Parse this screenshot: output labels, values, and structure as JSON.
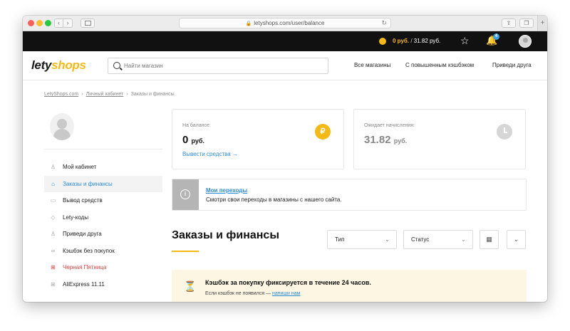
{
  "browser": {
    "url": "letyshops.com/user/balance",
    "back_glyph": "‹",
    "forward_glyph": "›",
    "new_tab_glyph": "+"
  },
  "topbar": {
    "balance_amount": "0 руб.",
    "balance_separator": "/",
    "pending_amount": "31.82 руб.",
    "notification_count": "4",
    "coin_color": "#f5b916"
  },
  "header": {
    "logo_part1": "lety",
    "logo_part2": "shops",
    "search_placeholder": "Найти магазин",
    "nav": [
      "Все магазины",
      "С повышенным кэшбэком",
      "Приведи друга"
    ]
  },
  "breadcrumb": {
    "items": [
      "LetyShops.com",
      "Личный кабинет",
      "Заказы и финансы"
    ],
    "separator": "›"
  },
  "sidebar": {
    "items": [
      {
        "label": "Мой кабинет",
        "icon": "user-icon"
      },
      {
        "label": "Заказы и финансы",
        "icon": "bag-icon"
      },
      {
        "label": "Вывод средств",
        "icon": "wallet-icon"
      },
      {
        "label": "Lety-коды",
        "icon": "tag-icon"
      },
      {
        "label": "Приведи друга",
        "icon": "add-user-icon"
      },
      {
        "label": "Кэшбэк без покупок",
        "icon": "link-icon"
      },
      {
        "label": "Черная Пятница",
        "icon": "gift-icon"
      },
      {
        "label": "AliExpress 11.11",
        "icon": "gift-icon"
      }
    ]
  },
  "balance_card": {
    "label": "На балансе:",
    "amount": "0",
    "currency": "руб.",
    "withdraw_link": "Вывести средства →",
    "icon_glyph": "₽"
  },
  "pending_card": {
    "label": "Ожидает начисления:",
    "amount": "31.82",
    "currency": "руб."
  },
  "info_banner": {
    "icon_glyph": "i",
    "title": "Мои переходы",
    "text": "Смотри свои переходы в магазины с нашего сайта."
  },
  "page": {
    "title": "Заказы и финансы"
  },
  "filters": {
    "type_label": "Тип",
    "status_label": "Статус",
    "calendar_glyph": "▦",
    "expand_glyph": "⌄"
  },
  "notice": {
    "icon_glyph": "⏳",
    "title": "Кэшбэк за покупку фиксируется в течение 24 часов.",
    "text_prefix": "Если кэшбэк не появился — ",
    "link_text": "напиши нам"
  }
}
